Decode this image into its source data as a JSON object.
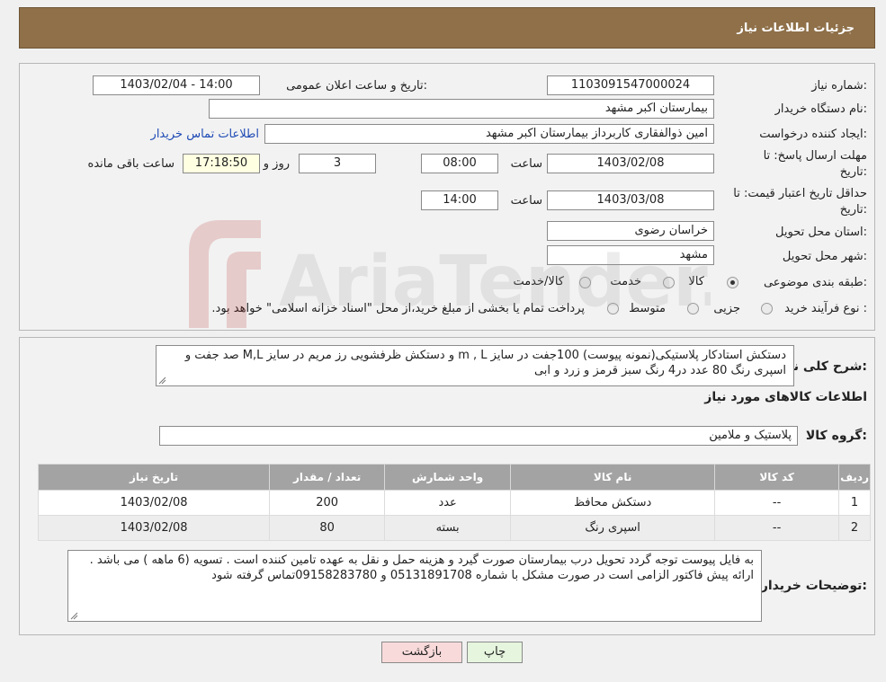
{
  "header": {
    "title": "جزئیات اطلاعات نیاز"
  },
  "form": {
    "need_number": {
      "label": "شماره نیاز:",
      "value": "1103091547000024"
    },
    "announce_datetime": {
      "label": "تاریخ و ساعت اعلان عمومی:",
      "value": "1403/02/04 - 14:00"
    },
    "buyer_org": {
      "label": "نام دستگاه خریدار:",
      "value": "بیمارستان اکبر مشهد"
    },
    "requester": {
      "label": "ایجاد کننده درخواست:",
      "value": "امین ذوالفقاری کاربرداز بیمارستان اکبر مشهد",
      "link": "اطلاعات تماس خریدار"
    },
    "send_deadline": {
      "label_line1": "مهلت ارسال پاسخ: تا",
      "label_line2": "تاریخ:",
      "date": "1403/02/08",
      "time_label": "ساعت",
      "time": "08:00",
      "days": "3",
      "days_label": "روز و",
      "remaining": "17:18:50",
      "remaining_label": "ساعت باقی مانده"
    },
    "price_validity": {
      "label_line1": "حداقل تاریخ اعتبار قیمت: تا",
      "label_line2": "تاریخ:",
      "date": "1403/03/08",
      "time_label": "ساعت",
      "time": "14:00"
    },
    "province": {
      "label": "استان محل تحویل:",
      "value": "خراسان رضوی"
    },
    "city": {
      "label": "شهر محل تحویل:",
      "value": "مشهد"
    },
    "category": {
      "label": "طبقه بندی موضوعی:",
      "options": [
        "کالا",
        "خدمت",
        "کالا/خدمت"
      ],
      "selected": "کالا"
    },
    "process": {
      "label": "نوع فرآیند خرید :",
      "options": [
        "جزیی",
        "متوسط"
      ],
      "note": "پرداخت تمام یا بخشی از مبلغ خرید،از محل \"اسناد خزانه اسلامی\" خواهد بود."
    }
  },
  "description": {
    "label": "شرح کلی نیاز:",
    "text": "دستکش استادکار پلاستیکی(نمونه پیوست) 100جفت در سایز m , L  و دستکش ظرفشویی رز مریم در سایز M,L صد جفت و اسپری رنگ 80 عدد در4 رنگ سبز قرمز و زرد و ابی"
  },
  "goods_info": {
    "title": "اطلاعات کالاهای مورد نیاز",
    "group_label": "گروه کالا:",
    "group_value": "پلاستیک و ملامین"
  },
  "table": {
    "headers": [
      "ردیف",
      "کد کالا",
      "نام کالا",
      "واحد شمارش",
      "تعداد / مقدار",
      "تاریخ نیاز"
    ],
    "rows": [
      [
        "1",
        "--",
        "دستکش محافظ",
        "عدد",
        "200",
        "1403/02/08"
      ],
      [
        "2",
        "--",
        "اسپری رنگ",
        "بسته",
        "80",
        "1403/02/08"
      ]
    ]
  },
  "buyer_notes": {
    "label": "توضیحات خریدار:",
    "text": "به فایل پیوست توجه گردد تحویل درب بیمارستان صورت گیرد و هزینه حمل و نقل به عهده تامین کننده است . تسویه (6 ماهه ) می باشد . ارائه پیش فاکتور الزامی است در صورت مشکل با شماره 05131891708  و 09158283780تماس گرفته شود"
  },
  "buttons": {
    "print": "چاپ",
    "back": "بازگشت"
  },
  "watermark_text": "AriaTender.neT",
  "colors": {
    "header_bg": "#8f7049",
    "print_btn": "#e6f5de",
    "back_btn": "#f9dada",
    "link": "#1f4bb5",
    "table_header": "#a3a3a3"
  }
}
